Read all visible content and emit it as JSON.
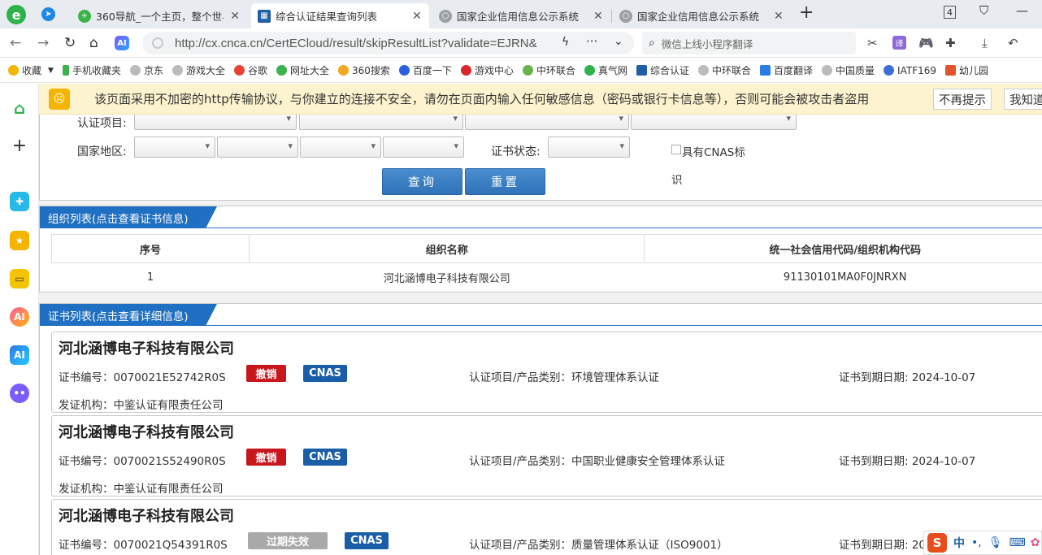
{
  "browser": {
    "tabs": [
      {
        "title": "360导航_一个主页，整个世界",
        "active": false
      },
      {
        "title": "综合认证结果查询列表",
        "active": true
      },
      {
        "title": "国家企业信用信息公示系统",
        "active": false
      },
      {
        "title": "国家企业信用信息公示系统",
        "active": false
      }
    ],
    "tab_count": "4",
    "url": "http://cx.cnca.cn/CertECloud/result/skipResultList?validate=EJRN&",
    "search_placeholder": "微信上线小程序翻译",
    "bookmarks": [
      "收藏",
      "手机收藏夹",
      "京东",
      "游戏大全",
      "谷歌",
      "网址大全",
      "360搜索",
      "百度一下",
      "游戏中心",
      "中环联合",
      "真气网",
      "综合认证",
      "中环联合",
      "百度翻译",
      "中国质量",
      "IATF169",
      "幼儿园"
    ]
  },
  "warning": {
    "text": "该页面采用不加密的http传输协议，与你建立的连接不安全，请勿在页面内输入任何敏感信息（密码或银行卡信息等），否则可能会被攻击者盗用",
    "dismiss": "不再提示",
    "know": "我知道"
  },
  "form": {
    "cert_item_label": "认证项目:",
    "region_label": "国家地区:",
    "status_label": "证书状态:",
    "cnas_label": "具有CNAS标",
    "cnas_label2": "识",
    "query_button": "查询",
    "reset_button": "重置"
  },
  "org_section": {
    "title": "组织列表(点击查看证书信息)",
    "columns": [
      "序号",
      "组织名称",
      "统一社会信用代码/组织机构代码"
    ],
    "rows": [
      [
        "1",
        "河北涵博电子科技有限公司",
        "91130101MA0F0JNRXN"
      ]
    ]
  },
  "cert_section": {
    "title": "证书列表(点击查看详细信息)",
    "cards": [
      {
        "company": "河北涵博电子科技有限公司",
        "cert_no": "证书编号：0070021E52742R0S",
        "status": "撤销",
        "status_color": "#c8161d",
        "cnas": "CNAS",
        "item": "认证项目/产品类别：环境管理体系认证",
        "expiry": "证书到期日期: 2024-10-07",
        "issuer": "发证机构：中鉴认证有限责任公司"
      },
      {
        "company": "河北涵博电子科技有限公司",
        "cert_no": "证书编号：0070021S52490R0S",
        "status": "撤销",
        "status_color": "#c8161d",
        "cnas": "CNAS",
        "item": "认证项目/产品类别：中国职业健康安全管理体系认证",
        "expiry": "证书到期日期: 2024-10-07",
        "issuer": "发证机构：中鉴认证有限责任公司"
      },
      {
        "company": "河北涵博电子科技有限公司",
        "cert_no": "证书编号：0070021Q54391R0S",
        "status": "过期失效",
        "status_color": "#a9a9a9",
        "cnas": "CNAS",
        "item": "认证项目/产品类别：质量管理体系认证（ISO9001）",
        "expiry": "证书到期日期: 20",
        "issuer": ""
      }
    ]
  },
  "ime": {
    "lang": "中",
    "punct": "•,"
  },
  "colors": {
    "accent": "#1f6fc2",
    "revoked": "#c8161d",
    "expired": "#a9a9a9",
    "cnas": "#1a5ea8"
  }
}
